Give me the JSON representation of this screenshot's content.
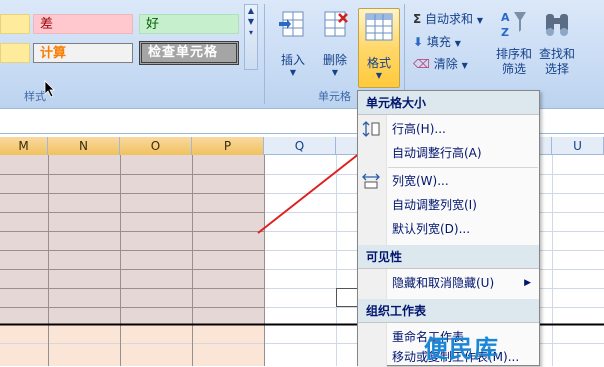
{
  "ribbon": {
    "styles_group": {
      "label": "样式",
      "cells": {
        "bad": "差",
        "good": "好",
        "calculation": "计算",
        "check_cell": "检查单元格"
      }
    },
    "cells_group": {
      "label": "单元格",
      "insert_label": "插入",
      "delete_label": "删除",
      "format_label": "格式"
    },
    "editing_group": {
      "autosum_label": "自动求和",
      "fill_label": "填充",
      "clear_label": "清除",
      "sort_filter_label": "排序和\n筛选",
      "find_select_label": "查找和\n选择"
    }
  },
  "grid": {
    "columns": [
      "M",
      "N",
      "O",
      "P",
      "Q",
      "U"
    ]
  },
  "format_menu": {
    "cell_size_header": "单元格大小",
    "row_height": "行高(H)...",
    "autofit_row_height": "自动调整行高(A)",
    "column_width": "列宽(W)...",
    "autofit_column_width": "自动调整列宽(I)",
    "default_width": "默认列宽(D)...",
    "visibility_header": "可见性",
    "hide_unhide": "隐藏和取消隐藏(U)",
    "organize_header": "组织工作表",
    "rename_sheet": "重命名工作表",
    "move_copy_sheet": "移动或复制工作表(M)..."
  },
  "watermark": "便民库",
  "colors": {
    "ribbon_bg": "#c9dcf4",
    "selected_header": "#f1c15f",
    "selected_cells": "#e6d7d7",
    "arrow": "#e02020",
    "menu_header_bg": "#dde7ee"
  }
}
